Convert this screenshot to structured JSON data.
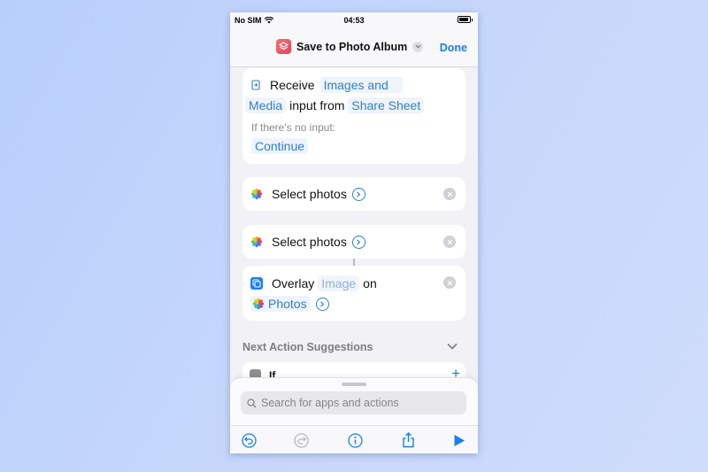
{
  "status": {
    "carrier": "No SIM",
    "time": "04:53"
  },
  "nav": {
    "title": "Save to Photo Album",
    "done": "Done"
  },
  "receive": {
    "verb": "Receive",
    "types": "Images and",
    "types2": "Media",
    "from": "input from",
    "source": "Share Sheet",
    "no_input_label": "If there's no input:",
    "no_input_action": "Continue"
  },
  "actions": [
    {
      "label": "Select photos"
    },
    {
      "label": "Select photos"
    }
  ],
  "overlay": {
    "verb": "Overlay",
    "image_placeholder": "Image",
    "on": "on",
    "target": "Photos"
  },
  "suggestions": {
    "heading": "Next Action Suggestions",
    "first": "If"
  },
  "search": {
    "placeholder": "Search for apps and actions"
  },
  "colors": {
    "accent": "#1a7ef2",
    "token_text": "#2f80c8",
    "background": "#c5d6fb"
  }
}
